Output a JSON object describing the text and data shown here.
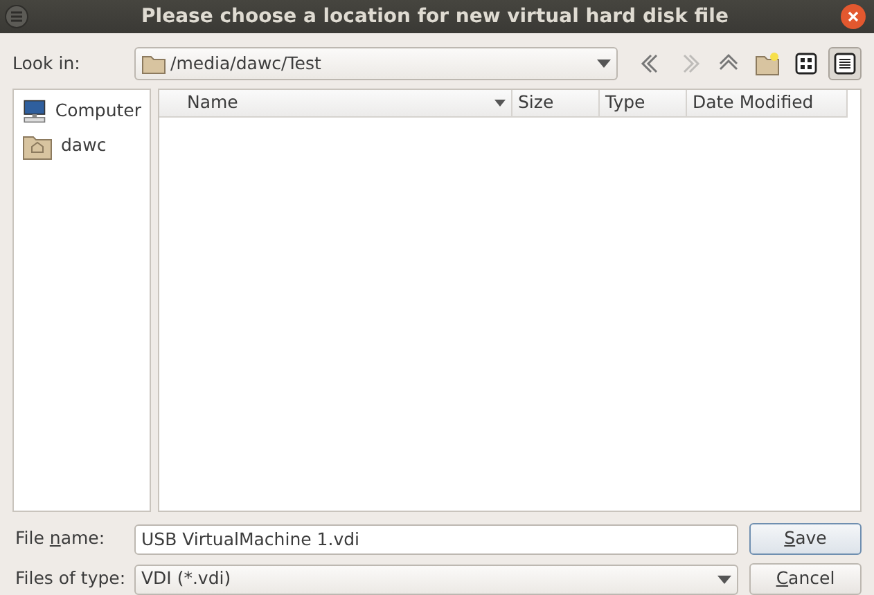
{
  "window": {
    "title": "Please choose a location for new virtual hard disk file"
  },
  "look_in": {
    "label": "Look in:",
    "value": "/media/dawc/Test"
  },
  "toolbar": [
    {
      "kind": "back",
      "disabled": false,
      "selected": false
    },
    {
      "kind": "forward",
      "disabled": true,
      "selected": false
    },
    {
      "kind": "up",
      "disabled": false,
      "selected": false
    },
    {
      "kind": "new-folder",
      "disabled": false,
      "selected": false
    },
    {
      "kind": "icon-view",
      "disabled": false,
      "selected": false
    },
    {
      "kind": "detail-view",
      "disabled": false,
      "selected": true
    }
  ],
  "sidebar": {
    "items": [
      {
        "kind": "computer",
        "label": "Computer"
      },
      {
        "kind": "home",
        "label": "dawc"
      }
    ]
  },
  "table": {
    "columns": [
      "Name",
      "Size",
      "Type",
      "Date Modified"
    ]
  },
  "file_name": {
    "label": {
      "before": "File ",
      "key": "n",
      "after": "ame:"
    },
    "value": "USB VirtualMachine 1.vdi"
  },
  "file_type": {
    "label": "Files of type:",
    "value": "VDI (*.vdi)"
  },
  "buttons": [
    {
      "key": "S",
      "after": "ave",
      "default": true
    },
    {
      "key": "C",
      "after": "ancel",
      "default": false
    }
  ]
}
